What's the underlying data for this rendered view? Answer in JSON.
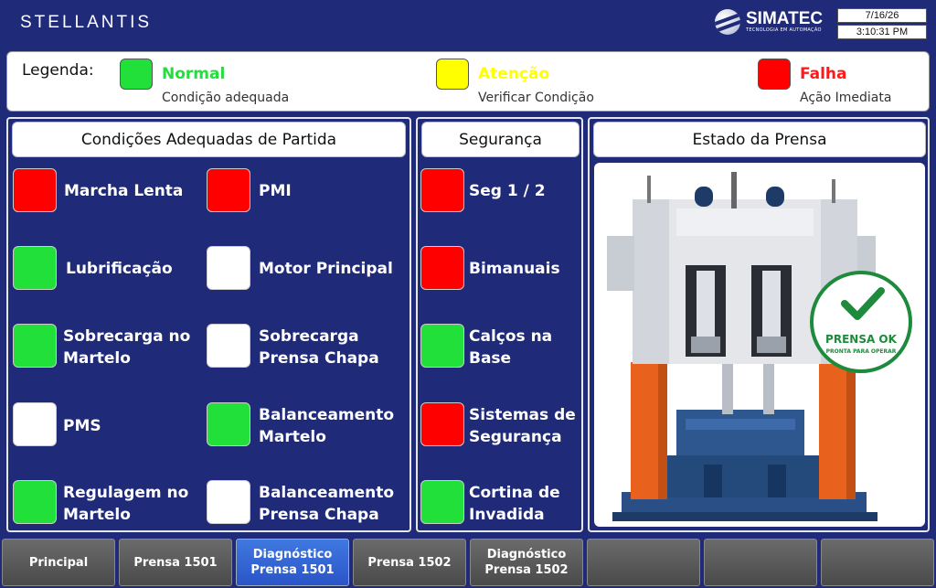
{
  "header": {
    "brand": "STELLANTIS",
    "vendor_name": "SIMATEC",
    "vendor_tagline": "TECNOLOGIA EM AUTOMAÇÃO",
    "date": "7/16/26",
    "time": "3:10:31 PM"
  },
  "legend": {
    "title": "Legenda:",
    "items": [
      {
        "name": "Normal",
        "desc": "Condição adequada",
        "color": "#22e03a"
      },
      {
        "name": "Atenção",
        "desc": "Verificar Condição",
        "color": "#ffff00"
      },
      {
        "name": "Falha",
        "desc": "Ação Imediata",
        "color": "#ff0000"
      }
    ]
  },
  "colors": {
    "green": "#22e03a",
    "red": "#ff0000",
    "white": "#ffffff",
    "yellow": "#ffff00",
    "panel_bg": "#1f2a78"
  },
  "conditions": {
    "title": "Condições Adequadas de Partida",
    "items": [
      {
        "label": "Marcha Lenta",
        "status": "red"
      },
      {
        "label": "PMI",
        "status": "red"
      },
      {
        "label": "Lubrificação",
        "status": "green"
      },
      {
        "label": "Motor Principal",
        "status": "white"
      },
      {
        "label": "Sobrecarga no Martelo",
        "status": "green"
      },
      {
        "label": "Sobrecarga Prensa Chapa",
        "status": "white"
      },
      {
        "label": "PMS",
        "status": "white"
      },
      {
        "label": "Balanceamento Martelo",
        "status": "green"
      },
      {
        "label": "Regulagem no Martelo",
        "status": "green"
      },
      {
        "label": "Balanceamento Prensa Chapa",
        "status": "white"
      }
    ]
  },
  "safety": {
    "title": "Segurança",
    "items": [
      {
        "label": "Seg 1 / 2",
        "status": "red"
      },
      {
        "label": "Bimanuais",
        "status": "red"
      },
      {
        "label": "Calços na Base",
        "status": "green"
      },
      {
        "label": "Sistemas de Segurança",
        "status": "red"
      },
      {
        "label": "Cortina de Invadida",
        "status": "green"
      }
    ]
  },
  "press_state": {
    "title": "Estado da Prensa",
    "badge_main": "PRENSA OK",
    "badge_sub": "PRONTA PARA OPERAR",
    "icon": "check-icon"
  },
  "nav": {
    "buttons": [
      {
        "label": "Principal",
        "active": false
      },
      {
        "label": "Prensa 1501",
        "active": false
      },
      {
        "label": "Diagnóstico Prensa 1501",
        "active": true
      },
      {
        "label": "Prensa 1502",
        "active": false
      },
      {
        "label": "Diagnóstico Prensa 1502",
        "active": false
      },
      {
        "label": "",
        "active": false
      },
      {
        "label": "",
        "active": false
      },
      {
        "label": "",
        "active": false
      }
    ]
  }
}
